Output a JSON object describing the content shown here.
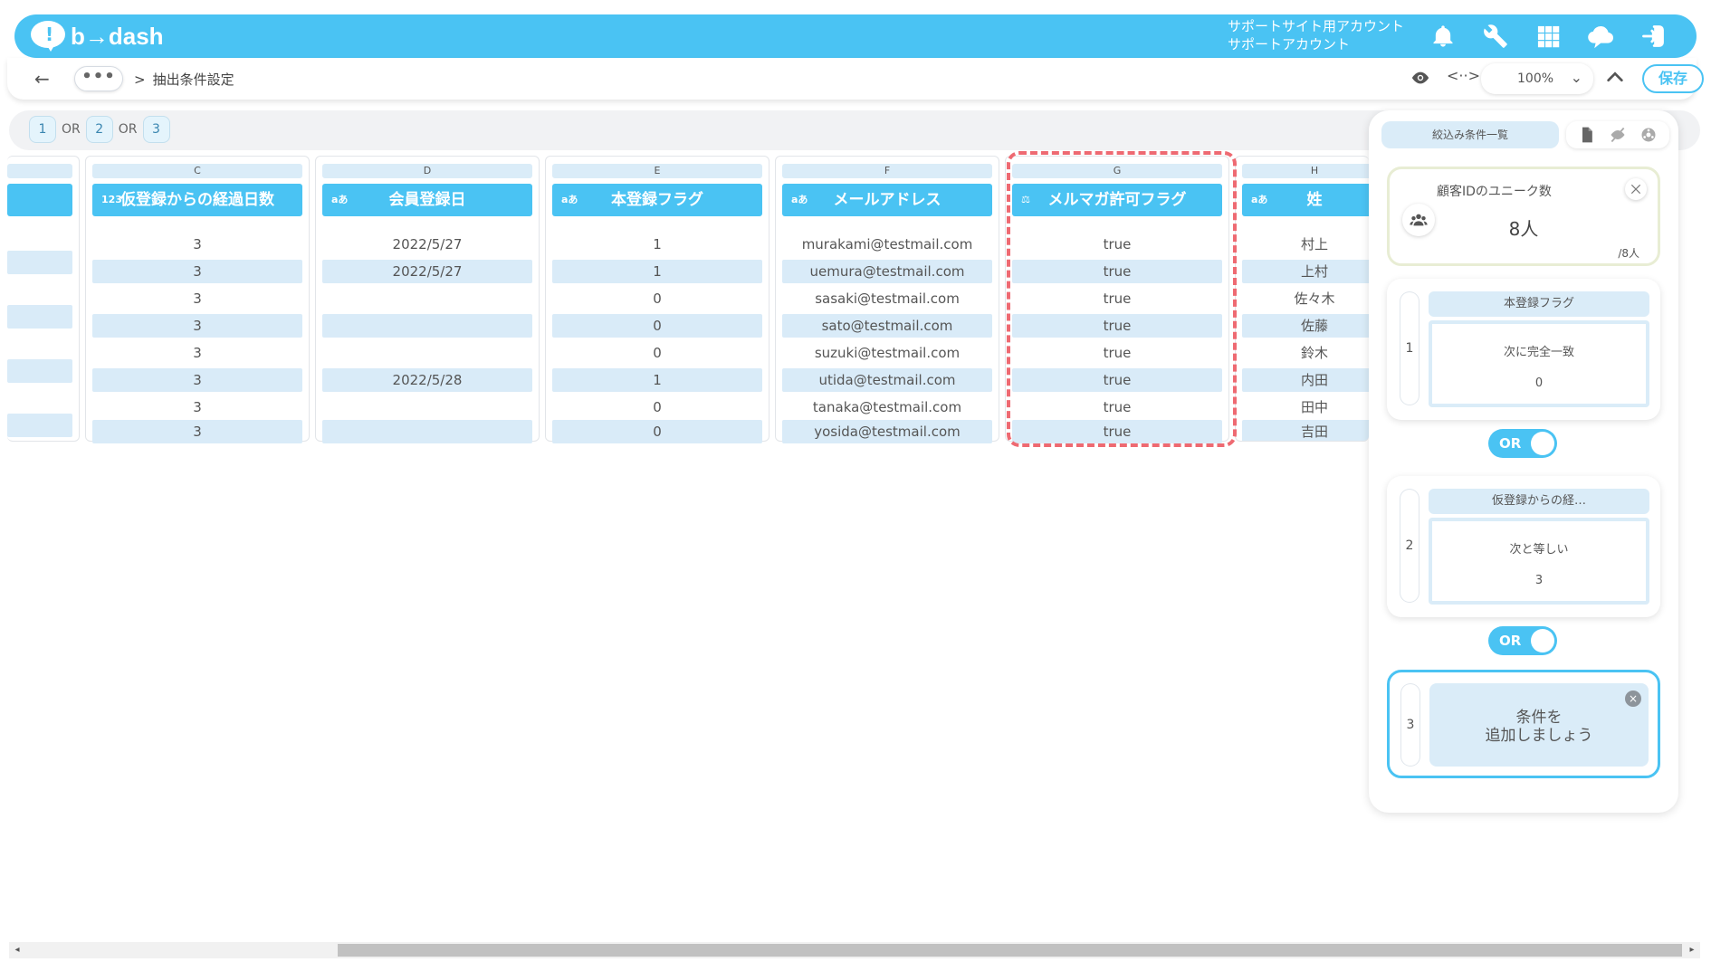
{
  "header": {
    "logo_text": "b→dash",
    "account_line1": "サポートサイト用アカウント",
    "account_line2": "サポートアカウント",
    "icons": [
      "bell-icon",
      "wrench-icon",
      "grid-icon",
      "chat-cloud-icon",
      "logout-icon"
    ]
  },
  "subbar": {
    "breadcrumb_sep": ">",
    "breadcrumb_current": "抽出条件設定",
    "zoom": "100%",
    "save_label": "保存"
  },
  "conditions_strip": {
    "chip1": "1",
    "or1": "OR",
    "chip2": "2",
    "or2": "OR",
    "chip3": "3"
  },
  "table": {
    "columns": [
      {
        "letter": "C",
        "type": "123",
        "title": "仮登録からの経過日数",
        "cells": [
          "3",
          "3",
          "3",
          "3",
          "3",
          "3",
          "3",
          "3"
        ]
      },
      {
        "letter": "D",
        "type": "aあ",
        "title": "会員登録日",
        "cells": [
          "2022/5/27",
          "2022/5/27",
          "",
          "",
          "",
          "2022/5/28",
          "",
          ""
        ]
      },
      {
        "letter": "E",
        "type": "aあ",
        "title": "本登録フラグ",
        "cells": [
          "1",
          "1",
          "0",
          "0",
          "0",
          "1",
          "0",
          "0"
        ]
      },
      {
        "letter": "F",
        "type": "aあ",
        "title": "メールアドレス",
        "cells": [
          "murakami@testmail.com",
          "uemura@testmail.com",
          "sasaki@testmail.com",
          "sato@testmail.com",
          "suzuki@testmail.com",
          "utida@testmail.com",
          "tanaka@testmail.com",
          "yosida@testmail.com"
        ]
      },
      {
        "letter": "G",
        "type": "⚖",
        "title": "メルマガ許可フラグ",
        "cells": [
          "true",
          "true",
          "true",
          "true",
          "true",
          "true",
          "true",
          "true"
        ]
      },
      {
        "letter": "H",
        "type": "aあ",
        "title": "姓",
        "cells": [
          "村上",
          "上村",
          "佐々木",
          "佐藤",
          "鈴木",
          "内田",
          "田中",
          "吉田"
        ]
      }
    ]
  },
  "panel": {
    "title": "絞込み条件一覧",
    "count_label": "顧客IDのユニーク数",
    "count_value": "8人",
    "count_total": "/8人",
    "conditions": [
      {
        "num": "1",
        "title": "本登録フラグ",
        "op": "次に完全一致",
        "value": "0"
      },
      {
        "num": "2",
        "title": "仮登録からの経…",
        "op": "次と等しい",
        "value": "3"
      }
    ],
    "toggle1": "OR",
    "toggle2": "OR",
    "add_num": "3",
    "add_line1": "条件を",
    "add_line2": "追加しましょう"
  },
  "colors": {
    "accent": "#4ac3f3",
    "highlight": "#ee6a72",
    "cell_alt": "#d9ebf8"
  }
}
